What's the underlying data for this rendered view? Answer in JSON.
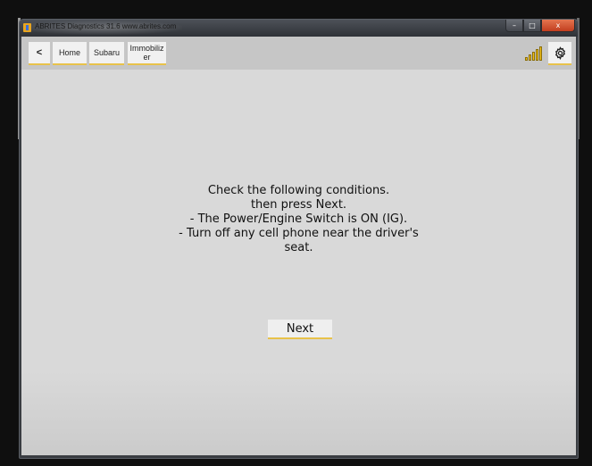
{
  "window": {
    "title": "ABRITES Diagnostics 31.6   www.abrites.com",
    "controls": {
      "minimize": "–",
      "maximize": "□",
      "close": "x"
    }
  },
  "toolbar": {
    "back_label": "<",
    "breadcrumbs": [
      {
        "label": "Home"
      },
      {
        "label": "Subaru"
      },
      {
        "label": "Immobiliz\ner"
      }
    ],
    "signal_level": "5/5",
    "settings_icon": "gear-icon"
  },
  "main": {
    "message_lines": [
      "Check the following conditions.",
      "then press Next.",
      "- The Power/Engine Switch is ON (IG).",
      "- Turn off any cell phone near the driver's",
      "seat."
    ],
    "next_label": "Next"
  },
  "colors": {
    "accent": "#e8c24a",
    "background": "#d9d9d9",
    "toolbar": "#c6c6c6",
    "close_button": "#d2532f"
  }
}
